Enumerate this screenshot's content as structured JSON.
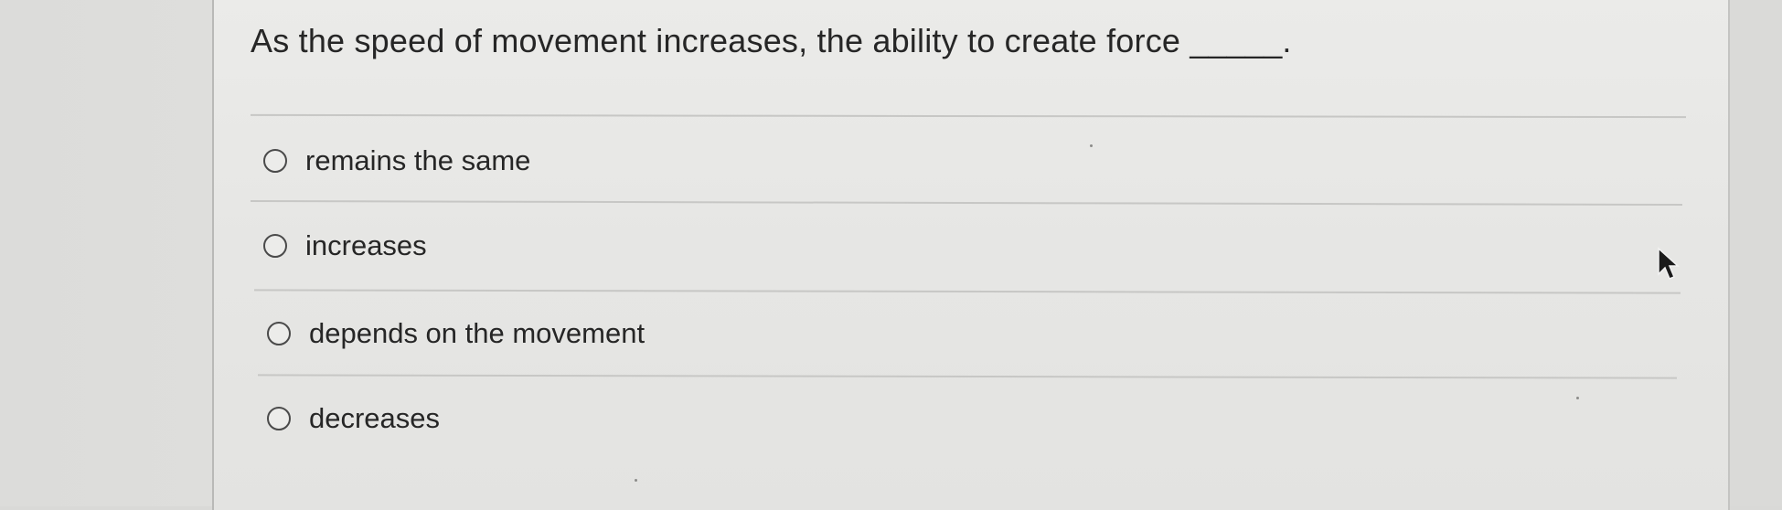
{
  "question": {
    "text": "As the speed of movement increases, the ability to create force _____."
  },
  "options": [
    {
      "label": "remains the same",
      "selected": false
    },
    {
      "label": "increases",
      "selected": false
    },
    {
      "label": "depends on the movement",
      "selected": false
    },
    {
      "label": "decreases",
      "selected": false
    }
  ],
  "cursor": {
    "icon": "mouse-pointer-arrow-icon"
  }
}
